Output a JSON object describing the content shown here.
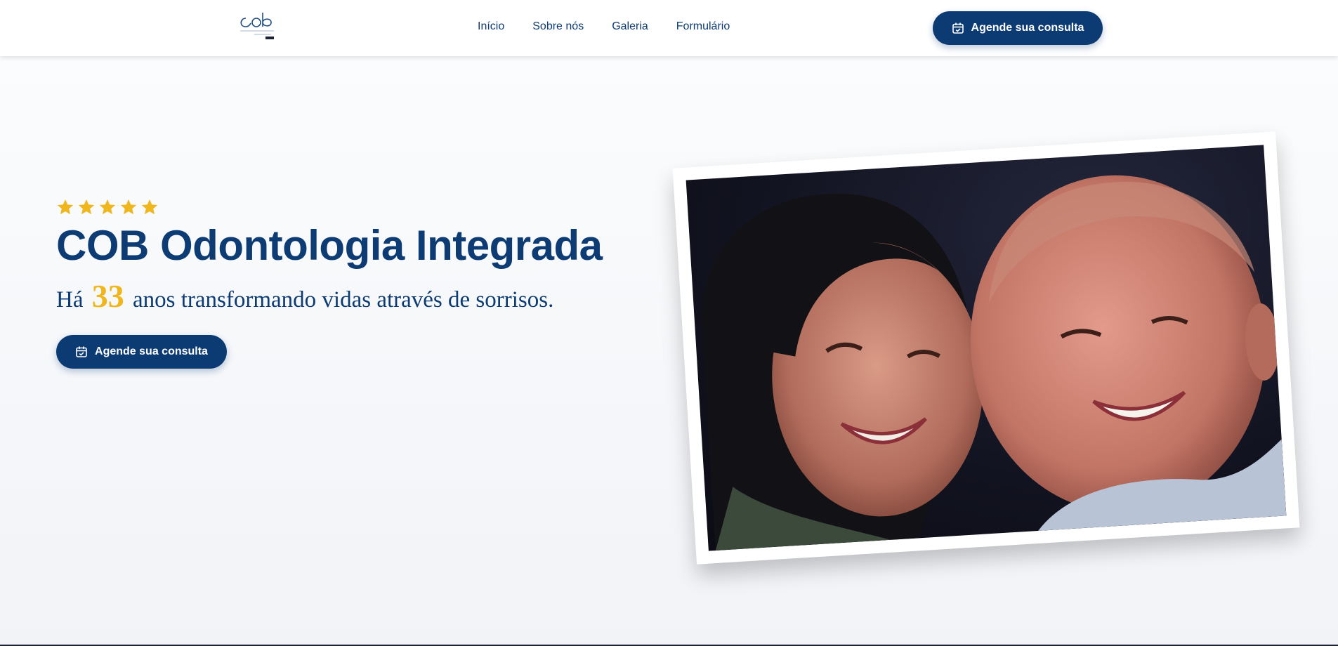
{
  "header": {
    "logo": {
      "icon": "cob-logo",
      "text": "cob"
    },
    "nav": [
      {
        "label": "Início"
      },
      {
        "label": "Sobre nós"
      },
      {
        "label": "Galeria"
      },
      {
        "label": "Formulário"
      }
    ],
    "cta": {
      "label": "Agende sua consulta",
      "icon": "calendar-check-icon"
    }
  },
  "hero": {
    "rating": {
      "stars": 5,
      "icon": "star-icon",
      "color": "#f0b61d"
    },
    "title": "COB Odontologia Integrada",
    "subtitle": {
      "before": "Há",
      "number": "33",
      "after": "anos transformando vidas através de sorrisos."
    },
    "cta": {
      "label": "Agende sua consulta",
      "icon": "calendar-check-icon"
    },
    "photo": {
      "subject": "smiling-senior-couple"
    }
  },
  "colors": {
    "primary": "#0c3b74",
    "accent": "#f0b61d",
    "background": "#f7f8fa"
  }
}
